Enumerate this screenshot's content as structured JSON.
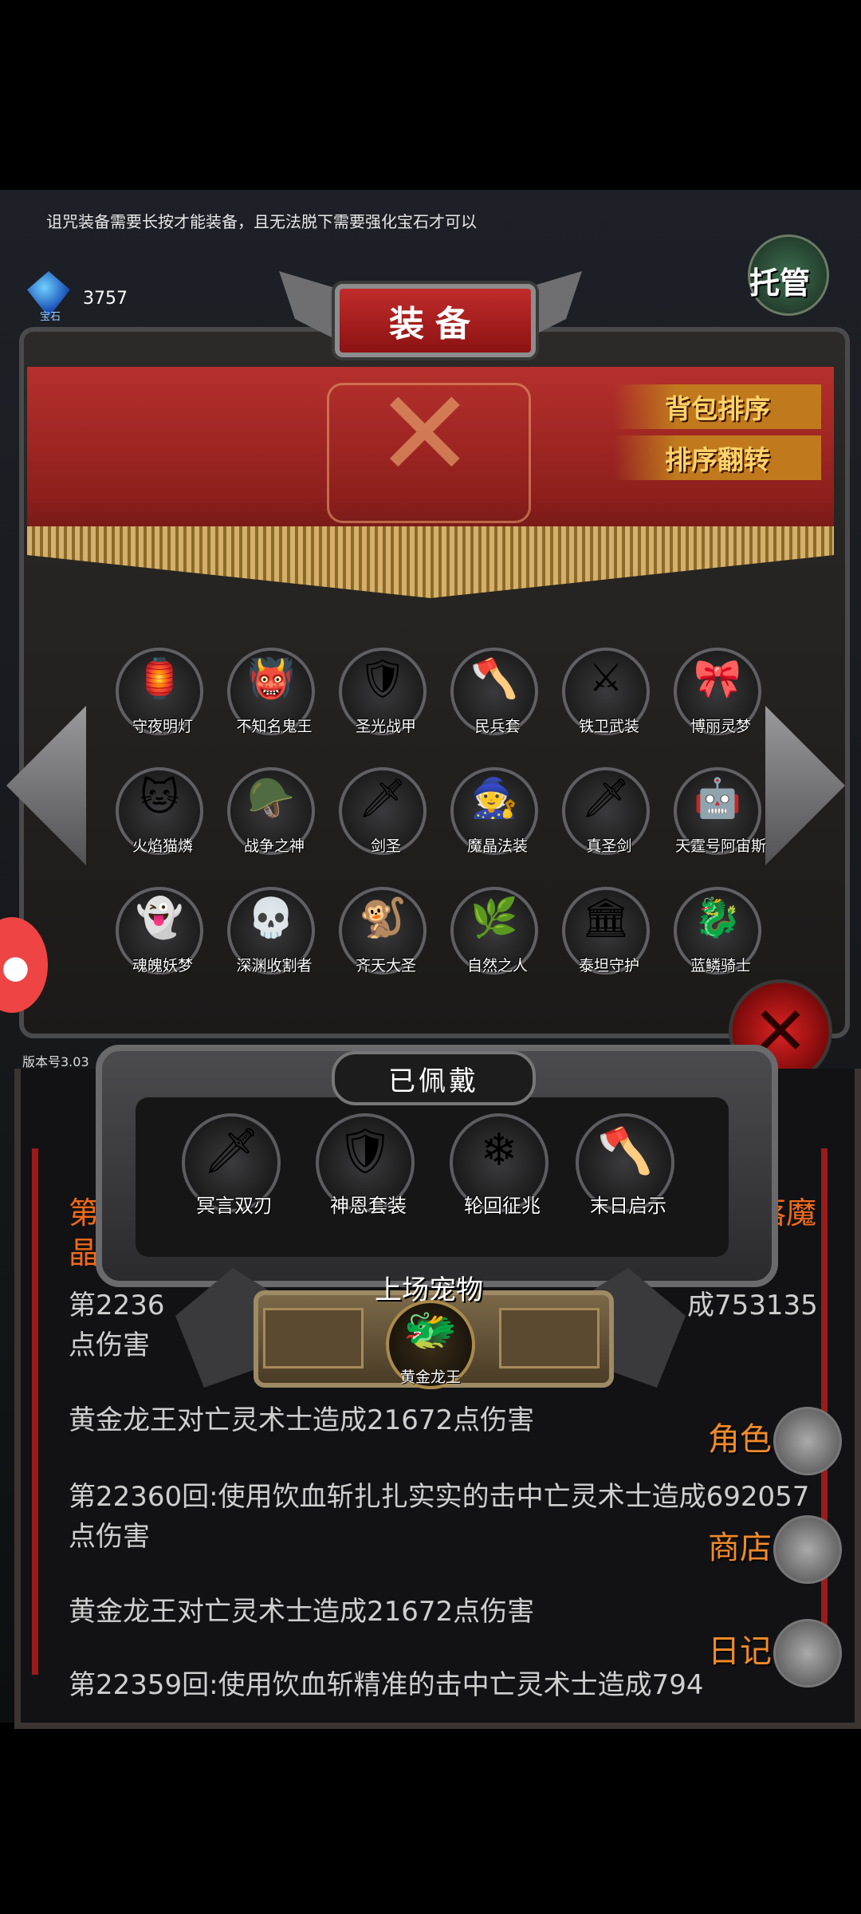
{
  "hint": "诅咒装备需要长按才能装备，且无法脱下需要强化宝石才可以",
  "gem": {
    "caption": "宝石",
    "count": "3757"
  },
  "auto_button": "托管",
  "panel_title": "装备",
  "sort_buttons": {
    "sort": "背包排序",
    "reverse": "排序翻转"
  },
  "equipment_items": [
    {
      "label": "守夜明灯",
      "icon": "lantern-icon",
      "glyph": "🏮"
    },
    {
      "label": "不知名鬼王",
      "icon": "ghost-king-icon",
      "glyph": "👹"
    },
    {
      "label": "圣光战甲",
      "icon": "armor-icon",
      "glyph": "🛡"
    },
    {
      "label": "民兵套",
      "icon": "militia-icon",
      "glyph": "🪓"
    },
    {
      "label": "铁卫武装",
      "icon": "iron-guard-icon",
      "glyph": "⚔"
    },
    {
      "label": "博丽灵梦",
      "icon": "shrine-maiden-icon",
      "glyph": "🎀"
    },
    {
      "label": "火焰猫燐",
      "icon": "fire-cat-icon",
      "glyph": "🐱"
    },
    {
      "label": "战争之神",
      "icon": "war-god-icon",
      "glyph": "🪖"
    },
    {
      "label": "剑圣",
      "icon": "sword-saint-icon",
      "glyph": "🗡"
    },
    {
      "label": "魔晶法装",
      "icon": "wizard-icon",
      "glyph": "🧙"
    },
    {
      "label": "真圣剑",
      "icon": "holy-sword-icon",
      "glyph": "🗡"
    },
    {
      "label": "天霆号阿宙斯",
      "icon": "mech-icon",
      "glyph": "🤖"
    },
    {
      "label": "魂魄妖梦",
      "icon": "youmu-icon",
      "glyph": "👻"
    },
    {
      "label": "深渊收割者",
      "icon": "reaper-icon",
      "glyph": "💀"
    },
    {
      "label": "齐天大圣",
      "icon": "monkey-king-icon",
      "glyph": "🐒"
    },
    {
      "label": "自然之人",
      "icon": "nature-man-icon",
      "glyph": "🌿"
    },
    {
      "label": "泰坦守护",
      "icon": "titan-icon",
      "glyph": "🏛"
    },
    {
      "label": "蓝鳞骑士",
      "icon": "blue-knight-icon",
      "glyph": "🐉"
    }
  ],
  "worn_title": "已佩戴",
  "worn_items": [
    {
      "label": "冥言双刃",
      "icon": "dual-blades-icon",
      "glyph": "🗡"
    },
    {
      "label": "神恩套装",
      "icon": "divine-armor-icon",
      "glyph": "🛡"
    },
    {
      "label": "轮回征兆",
      "icon": "crystal-staff-icon",
      "glyph": "❄"
    },
    {
      "label": "末日启示",
      "icon": "doom-axe-icon",
      "glyph": "🪓"
    }
  ],
  "pet": {
    "title": "上场宠物",
    "name": "黄金龙王",
    "icon": "golden-dragon-icon",
    "glyph": "🐲"
  },
  "version": "版本号3.03",
  "log": {
    "orange_left": "第",
    "orange_left2": "晶",
    "orange_right": "落魔",
    "line1a": "第2236",
    "line1b": "成753135",
    "line1c": "点伤害",
    "line2": "黄金龙王对亡灵术士造成21672点伤害",
    "line3": "第22360回:使用饮血斩扎扎实实的击中亡灵术士造成692057点伤害",
    "line4": "黄金龙王对亡灵术士造成21672点伤害",
    "line5": "第22359回:使用饮血斩精准的击中亡灵术士造成794"
  },
  "side_menu": [
    {
      "label": "角色",
      "icon": "helmet-icon",
      "glyph": "⛑"
    },
    {
      "label": "商店",
      "icon": "beer-mug-icon",
      "glyph": "🍺"
    },
    {
      "label": "日记",
      "icon": "journal-icon",
      "glyph": "📘"
    }
  ]
}
